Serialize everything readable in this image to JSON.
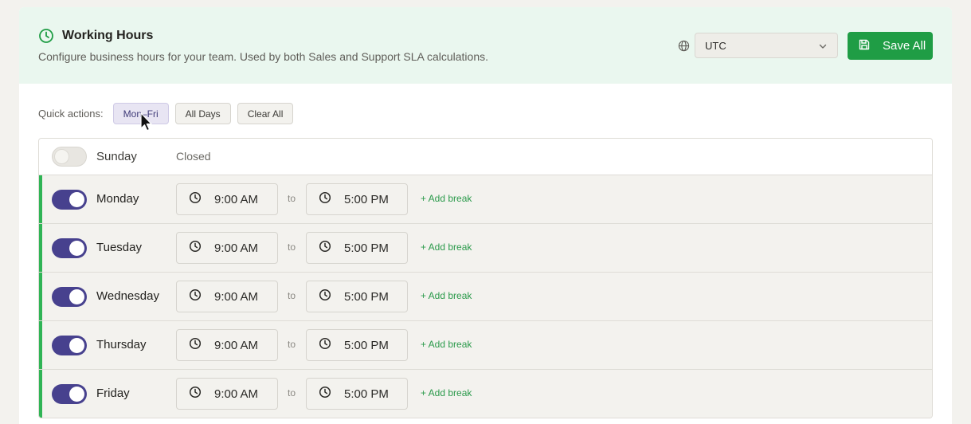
{
  "header": {
    "title": "Working Hours",
    "subtitle": "Configure business hours for your team. Used by both Sales and Support SLA calculations.",
    "title_icon": "clock-icon",
    "timezone": {
      "icon": "globe-icon",
      "value": "UTC"
    },
    "save_label": "Save All"
  },
  "quick_actions": {
    "label": "Quick actions:",
    "buttons": [
      "Mon–Fri",
      "All Days",
      "Clear All"
    ]
  },
  "days": [
    {
      "name": "Sunday",
      "enabled": false,
      "status": "Closed"
    },
    {
      "name": "Monday",
      "enabled": true,
      "start": "9:00 AM",
      "end": "5:00 PM"
    },
    {
      "name": "Tuesday",
      "enabled": true,
      "start": "9:00 AM",
      "end": "5:00 PM"
    },
    {
      "name": "Wednesday",
      "enabled": true,
      "start": "9:00 AM",
      "end": "5:00 PM"
    },
    {
      "name": "Thursday",
      "enabled": true,
      "start": "9:00 AM",
      "end": "5:00 PM"
    },
    {
      "name": "Friday",
      "enabled": true,
      "start": "9:00 AM",
      "end": "5:00 PM"
    }
  ],
  "labels": {
    "to": "to",
    "add_break": "+ Add break"
  },
  "colors": {
    "accent_green": "#1f9d45",
    "toggle_on": "#47418e",
    "header_bg": "#eaf7ef"
  }
}
